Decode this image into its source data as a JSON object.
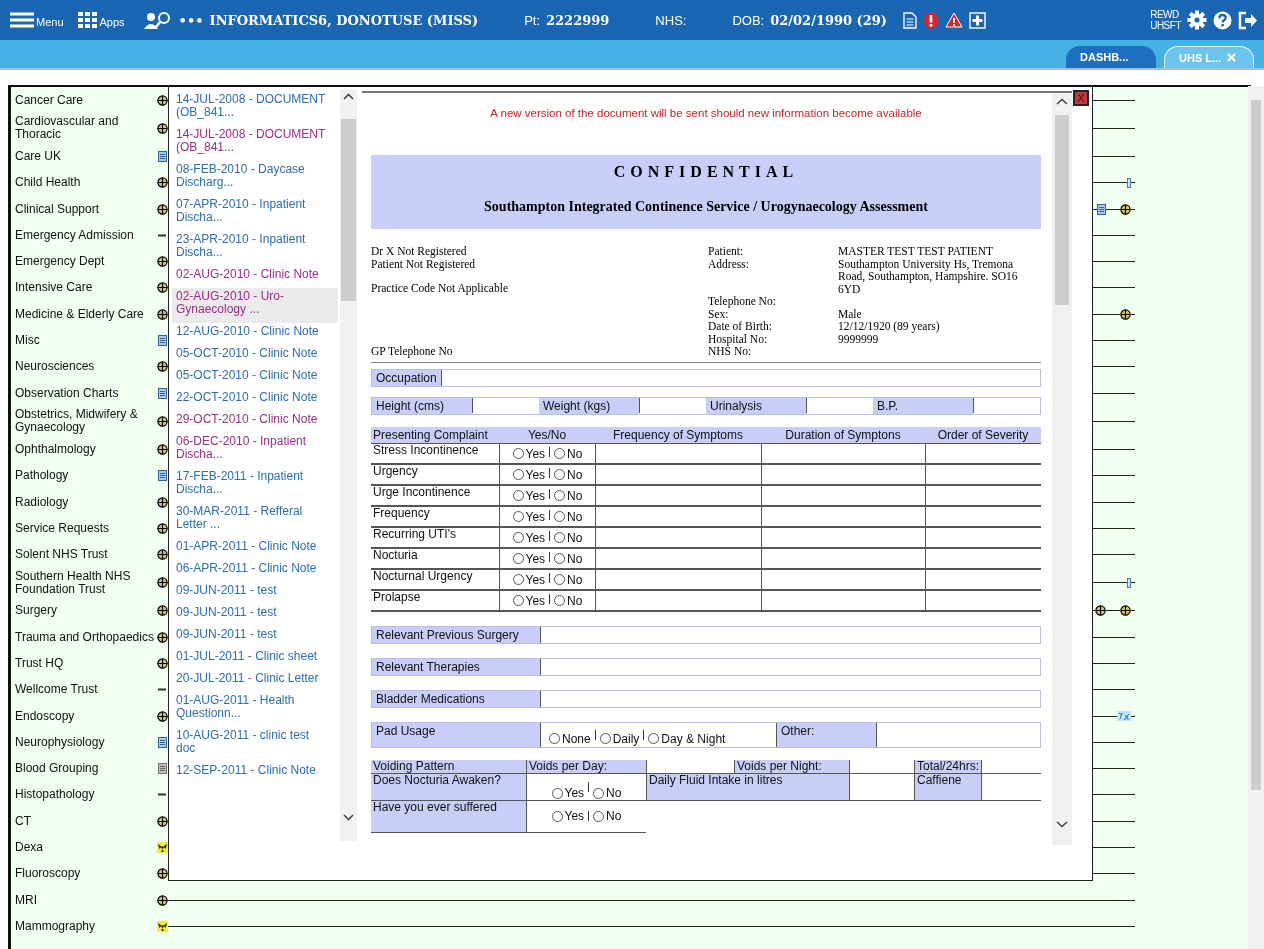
{
  "header": {
    "menu_label": "Menu",
    "apps_label": "Apps",
    "dots": "•••",
    "patient_name": "INFORMATICS6, DONOTUSE (MISS)",
    "pt_label": "Pt:",
    "pt_value": "2222999",
    "nhs_label": "NHS:",
    "dob_label": "DOB:",
    "dob_value": "02/02/1990 (29)",
    "site_line1": "REWD",
    "site_line2": "UHSFT"
  },
  "tabs": [
    {
      "label": "DASHB...",
      "selected": false,
      "closable": false
    },
    {
      "label": "UHS L...",
      "selected": true,
      "closable": true
    }
  ],
  "categories": [
    {
      "label": "Cancer Care",
      "icon": {
        "kind": "cross"
      }
    },
    {
      "label": "Cardiovascular and Thoracic",
      "icon": {
        "kind": "cross"
      }
    },
    {
      "label": "Care UK",
      "icon": {
        "kind": "doc"
      }
    },
    {
      "label": "Child Health",
      "icon": {
        "kind": "cross"
      },
      "events": [
        {
          "kind": "tick"
        }
      ]
    },
    {
      "label": "Clinical Support",
      "icon": {
        "kind": "cross"
      },
      "events": [
        {
          "kind": "doc"
        },
        {
          "kind": "cross"
        }
      ]
    },
    {
      "label": "Emergency Admission",
      "icon": {
        "kind": "dash"
      }
    },
    {
      "label": "Emergency Dept",
      "icon": {
        "kind": "cross"
      }
    },
    {
      "label": "Intensive Care",
      "icon": {
        "kind": "cross"
      }
    },
    {
      "label": "Medicine & Elderly Care",
      "icon": {
        "kind": "cross"
      },
      "events": [
        {
          "kind": "cross"
        }
      ]
    },
    {
      "label": "Misc",
      "icon": {
        "kind": "doc"
      }
    },
    {
      "label": "Neurosciences",
      "icon": {
        "kind": "cross"
      }
    },
    {
      "label": "Observation Charts",
      "icon": {
        "kind": "doc"
      }
    },
    {
      "label": "Obstetrics, Midwifery & Gynaecology",
      "icon": {
        "kind": "cross"
      }
    },
    {
      "label": "Ophthalmology",
      "icon": {
        "kind": "cross"
      }
    },
    {
      "label": "Pathology",
      "icon": {
        "kind": "doc"
      }
    },
    {
      "label": "Radiology",
      "icon": {
        "kind": "cross"
      }
    },
    {
      "label": "Service Requests",
      "icon": {
        "kind": "cross"
      }
    },
    {
      "label": "Solent NHS Trust",
      "icon": {
        "kind": "cross"
      }
    },
    {
      "label": "Southern Health NHS Foundation Trust",
      "icon": {
        "kind": "cross"
      },
      "events": [
        {
          "kind": "tick"
        }
      ]
    },
    {
      "label": "Surgery",
      "icon": {
        "kind": "cross"
      },
      "events": [
        {
          "kind": "cross"
        },
        {
          "kind": "cross"
        }
      ]
    },
    {
      "label": "Trauma and Orthopaedics",
      "icon": {
        "kind": "cross"
      }
    },
    {
      "label": "Trust HQ",
      "icon": {
        "kind": "cross"
      }
    },
    {
      "label": "Wellcome Trust",
      "icon": {
        "kind": "dash"
      }
    },
    {
      "label": "Endoscopy",
      "icon": {
        "kind": "cross"
      },
      "events": [
        {
          "kind": "half"
        }
      ]
    },
    {
      "label": "Neurophysiology",
      "icon": {
        "kind": "doc"
      }
    },
    {
      "label": "Blood Grouping",
      "icon": {
        "kind": "greydoc"
      }
    },
    {
      "label": "Histopathology",
      "icon": {
        "kind": "dash"
      }
    },
    {
      "label": "CT",
      "icon": {
        "kind": "cross"
      }
    },
    {
      "label": "Dexa",
      "icon": {
        "kind": "hazard"
      }
    },
    {
      "label": "Fluoroscopy",
      "icon": {
        "kind": "cross"
      }
    },
    {
      "label": "MRI",
      "icon": {
        "kind": "cross"
      }
    },
    {
      "label": "Mammography",
      "icon": {
        "kind": "hazard"
      }
    }
  ],
  "documents": [
    {
      "label": "14-JUL-2008 - DOCUMENT (OB_841...",
      "visited": false,
      "selected": false
    },
    {
      "label": "14-JUL-2008 - DOCUMENT (OB_841...",
      "visited": true,
      "selected": false
    },
    {
      "label": "08-FEB-2010 - Daycase Discharg...",
      "visited": false,
      "selected": false
    },
    {
      "label": "07-APR-2010 - Inpatient Discha...",
      "visited": false,
      "selected": false
    },
    {
      "label": "23-APR-2010 - Inpatient Discha...",
      "visited": false,
      "selected": false
    },
    {
      "label": "02-AUG-2010 - Clinic Note",
      "visited": true,
      "selected": false
    },
    {
      "label": "02-AUG-2010 - Uro-Gynaecology ...",
      "visited": true,
      "selected": true
    },
    {
      "label": "12-AUG-2010 - Clinic Note",
      "visited": false,
      "selected": false
    },
    {
      "label": "05-OCT-2010 - Clinic Note",
      "visited": false,
      "selected": false
    },
    {
      "label": "05-OCT-2010 - Clinic Note",
      "visited": false,
      "selected": false
    },
    {
      "label": "22-OCT-2010 - Clinic Note",
      "visited": false,
      "selected": false
    },
    {
      "label": "29-OCT-2010 - Clinic Note",
      "visited": true,
      "selected": false
    },
    {
      "label": "06-DEC-2010 - Inpatient Discha...",
      "visited": true,
      "selected": false
    },
    {
      "label": "17-FEB-2011 - Inpatient Discha...",
      "visited": false,
      "selected": false
    },
    {
      "label": "30-MAR-2011 - Refferal Letter ...",
      "visited": false,
      "selected": false
    },
    {
      "label": "01-APR-2011 - Clinic Note",
      "visited": false,
      "selected": false
    },
    {
      "label": "06-APR-2011 - Clinic Note",
      "visited": false,
      "selected": false
    },
    {
      "label": "09-JUN-2011 - test",
      "visited": false,
      "selected": false
    },
    {
      "label": "09-JUN-2011 - test",
      "visited": false,
      "selected": false
    },
    {
      "label": "09-JUN-2011 - test",
      "visited": false,
      "selected": false
    },
    {
      "label": "01-JUL-2011 - Clinic sheet",
      "visited": false,
      "selected": false
    },
    {
      "label": "20-JUL-2011 - Clinic Letter",
      "visited": false,
      "selected": false
    },
    {
      "label": "01-AUG-2011 - Health Questionn...",
      "visited": false,
      "selected": false
    },
    {
      "label": "10-AUG-2011 - clinic test doc",
      "visited": false,
      "selected": false
    },
    {
      "label": "12-SEP-2011 - Clinic Note",
      "visited": false,
      "selected": false
    }
  ],
  "viewer": {
    "close_label": "X",
    "notice": "A new version of the document will be sent should new information become available",
    "heading": "CONFIDENTIAL",
    "title": "Southampton Integrated Continence Service / Urogynaecology Assessment",
    "practice_lines": [
      "Dr X Not Registered",
      "Patient Not Registered"
    ],
    "practice_code": "Practice Code Not Applicable",
    "gp_phone": "GP Telephone No",
    "patient_fields": [
      {
        "label": "Patient:",
        "value": "MASTER TEST TEST PATIENT"
      },
      {
        "label": "Address:",
        "value": "Southampton University Hs, Tremona Road, Southampton, Hampshire. SO16 6YD"
      },
      {
        "label": "Telephone No:"
      },
      {
        "label": "Sex:",
        "value": "Male"
      },
      {
        "label": "Date of Birth:",
        "value": "12/12/1920 (89 years)"
      },
      {
        "label": "Hospital No:",
        "value": "9999999"
      },
      {
        "label": "NHS No:"
      }
    ],
    "occupation": "Occupation",
    "measurements": [
      "Height (cms)",
      "Weight (kgs)",
      "Urinalysis",
      "B.P."
    ],
    "complaint_columns": [
      "Presenting Complaint",
      "Yes/No",
      "Frequency of Symptoms",
      "Duration of Symptons",
      "Order of Severity"
    ],
    "complaints": [
      {
        "name": "Stress Incontinence",
        "options": [
          {
            "label": "Yes",
            "selected": false
          },
          {
            "label": "No",
            "selected": false
          }
        ]
      },
      {
        "name": "Urgency",
        "options": [
          {
            "label": "Yes",
            "selected": false
          },
          {
            "label": "No",
            "selected": false
          }
        ]
      },
      {
        "name": "Urge Incontinence",
        "options": [
          {
            "label": "Yes",
            "selected": false
          },
          {
            "label": "No",
            "selected": false
          }
        ]
      },
      {
        "name": "Frequency",
        "options": [
          {
            "label": "Yes",
            "selected": false
          },
          {
            "label": "No",
            "selected": false
          }
        ]
      },
      {
        "name": "Recurring UTI's",
        "options": [
          {
            "label": "Yes",
            "selected": false
          },
          {
            "label": "No",
            "selected": false
          }
        ]
      },
      {
        "name": "Nocturia",
        "options": [
          {
            "label": "Yes",
            "selected": false
          },
          {
            "label": "No",
            "selected": false
          }
        ]
      },
      {
        "name": "Nocturnal Urgency",
        "options": [
          {
            "label": "Yes",
            "selected": false
          },
          {
            "label": "No",
            "selected": false
          }
        ]
      },
      {
        "name": "Prolapse",
        "options": [
          {
            "label": "Yes",
            "selected": false
          },
          {
            "label": "No",
            "selected": false
          }
        ]
      }
    ],
    "text_fields": [
      "Relevant Previous Surgery",
      "Relevant Therapies",
      "Bladder Medications"
    ],
    "pad_usage": {
      "label": "Pad Usage",
      "options": [
        {
          "label": "None",
          "selected": false
        },
        {
          "label": "Daily",
          "selected": false
        },
        {
          "label": "Day & Night",
          "selected": false
        }
      ],
      "other_label": "Other:"
    },
    "voiding": {
      "pattern_label": "Voiding Pattern",
      "per_day_label": "Voids per Day:",
      "per_night_label": "Voids per Night:",
      "total_label": "Total/24hrs:",
      "nocturia_label": "Does Nocturia Awaken?",
      "nocturia_options": [
        {
          "label": "Yes",
          "selected": false
        },
        {
          "label": "No",
          "selected": false
        }
      ],
      "fluid_label": "Daily Fluid Intake in litres",
      "caffeine_label": "Caffiene",
      "retention_label": "Have you ever suffered",
      "retention_options": [
        {
          "label": "Yes",
          "selected": false
        },
        {
          "label": "No",
          "selected": false
        }
      ]
    }
  }
}
